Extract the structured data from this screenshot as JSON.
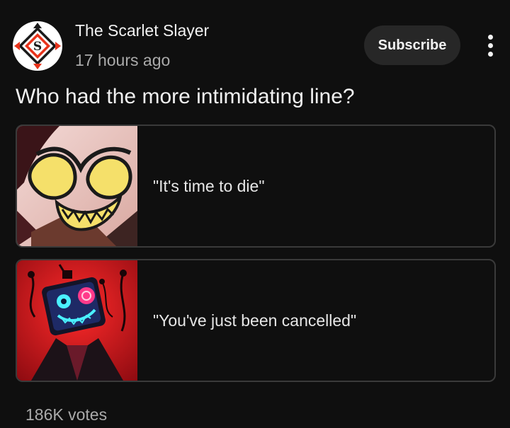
{
  "post": {
    "channel_name": "The Scarlet Slayer",
    "timestamp": "17 hours ago",
    "subscribe_label": "Subscribe",
    "question": "Who had the more intimidating line?",
    "options": [
      {
        "label": "\"It's time to die\"",
        "image": "alastor-grin-image"
      },
      {
        "label": "\"You've just been cancelled\"",
        "image": "vox-tv-head-image"
      }
    ],
    "votes": "186K votes"
  },
  "colors": {
    "background": "#0f0f0f",
    "text_primary": "#f1f1f1",
    "text_secondary": "#aaaaaa",
    "button_bg": "#272727",
    "option_border": "#3a3a3a",
    "avatar_red": "#e8341c"
  },
  "icons": {
    "menu": "more-vert-icon",
    "avatar": "scarlet-slayer-logo"
  }
}
